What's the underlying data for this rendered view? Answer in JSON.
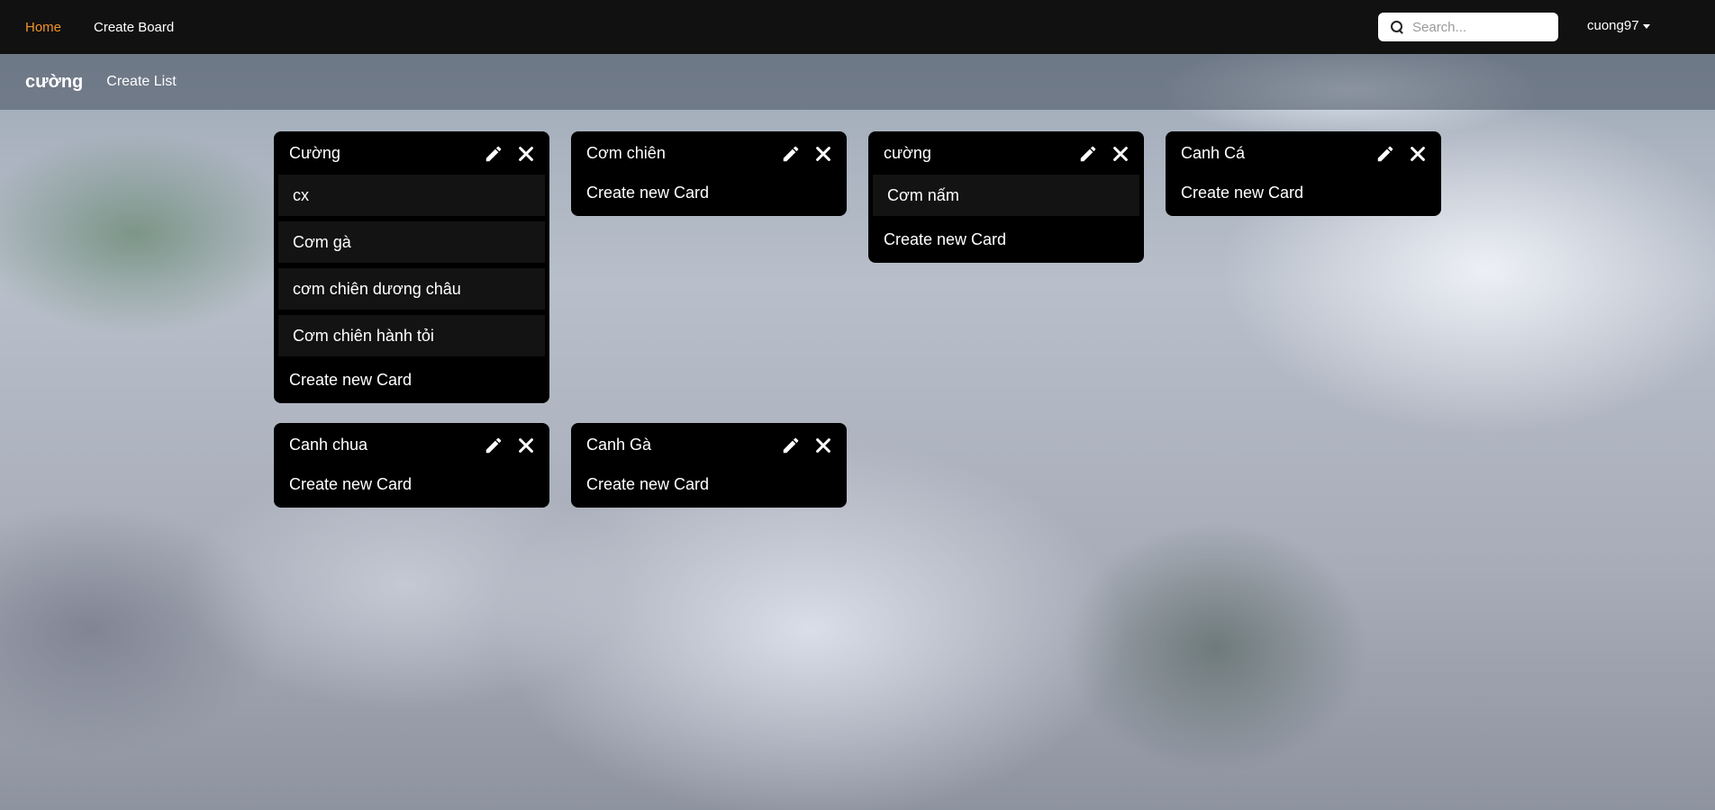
{
  "navbar": {
    "home_label": "Home",
    "create_board_label": "Create Board",
    "search_placeholder": "Search...",
    "user_name": "cuong97",
    "accent_color": "#f0932b"
  },
  "board": {
    "title": "cường",
    "create_list_label": "Create List"
  },
  "lists": [
    {
      "title": "Cường",
      "cards": [
        "cx",
        "Cơm gà",
        "cơm chiên dương châu",
        "Cơm chiên hành tỏi"
      ],
      "create_card_label": "Create new Card"
    },
    {
      "title": "Cơm chiên",
      "cards": [],
      "create_card_label": "Create new Card"
    },
    {
      "title": "cường",
      "cards": [
        "Cơm nấm"
      ],
      "create_card_label": "Create new Card"
    },
    {
      "title": "Canh Cá",
      "cards": [],
      "create_card_label": "Create new Card"
    },
    {
      "title": "Canh chua",
      "cards": [],
      "create_card_label": "Create new Card"
    },
    {
      "title": "Canh Gà",
      "cards": [],
      "create_card_label": "Create new Card"
    }
  ],
  "icons": {
    "edit": "pencil-icon",
    "delete": "close-icon",
    "search": "search-icon"
  }
}
